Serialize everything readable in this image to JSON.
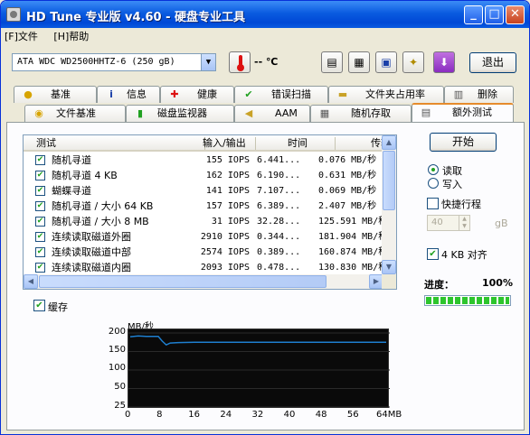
{
  "window": {
    "title": "HD Tune 专业版 v4.60 - 硬盘专业工具"
  },
  "menu": {
    "file": "[F]文件",
    "help": "[H]帮助"
  },
  "toolbar": {
    "disk": "ATA    WDC WD2500HHTZ-6 (250 gB)",
    "temperature": "-- ℃",
    "exit_label": "退出"
  },
  "tabs_top": [
    "基准",
    "信息",
    "健康",
    "错误扫描",
    "文件夹占用率",
    "删除"
  ],
  "tabs_bottom": [
    "文件基准",
    "磁盘监视器",
    "AAM",
    "随机存取",
    "额外测试"
  ],
  "table": {
    "headers": {
      "test": "测试",
      "io": "输入/输出",
      "time": "时间",
      "speed": "传输"
    },
    "rows": [
      {
        "name": "随机寻道",
        "io": "155 IOPS",
        "time": "6.441...",
        "speed": "0.076 MB/秒"
      },
      {
        "name": "随机寻道 4 KB",
        "io": "162 IOPS",
        "time": "6.190...",
        "speed": "0.631 MB/秒"
      },
      {
        "name": "蝴蝶寻道",
        "io": "141 IOPS",
        "time": "7.107...",
        "speed": "0.069 MB/秒"
      },
      {
        "name": "随机寻道 / 大小 64 KB",
        "io": "157 IOPS",
        "time": "6.389...",
        "speed": "2.407 MB/秒"
      },
      {
        "name": "随机寻道 / 大小 8 MB",
        "io": "31 IOPS",
        "time": "32.28...",
        "speed": "125.591 MB/秒"
      },
      {
        "name": "连续读取磁道外圈",
        "io": "2910 IOPS",
        "time": "0.344...",
        "speed": "181.904 MB/秒"
      },
      {
        "name": "连续读取磁道中部",
        "io": "2574 IOPS",
        "time": "0.389...",
        "speed": "160.874 MB/秒"
      },
      {
        "name": "连续读取磁道内圈",
        "io": "2093 IOPS",
        "time": "0.478...",
        "speed": "130.830 MB/秒"
      }
    ]
  },
  "side": {
    "start_label": "开始",
    "read_label": "读取",
    "write_label": "写入",
    "quick_label": "快捷行程",
    "quick_value": "40",
    "quick_unit": "gB",
    "align_label": "4 KB 对齐",
    "progress_label": "进度：",
    "progress_value": "100%"
  },
  "cache_label": "缓存",
  "chart_data": {
    "type": "line",
    "ylabel": "MB/秒",
    "yticks": [
      "200",
      "150",
      "100",
      "50",
      "25"
    ],
    "xticks": [
      "0",
      "8",
      "16",
      "24",
      "32",
      "40",
      "48",
      "56",
      "64MB"
    ],
    "ylim": [
      0,
      200
    ],
    "xlim": [
      0,
      64
    ],
    "x": [
      0,
      2,
      4,
      6,
      7,
      8,
      9,
      10,
      12,
      16,
      24,
      32,
      40,
      48,
      56,
      64
    ],
    "values": [
      190,
      192,
      191,
      191,
      191,
      178,
      168,
      173,
      174,
      175,
      175,
      175,
      175,
      175,
      175,
      175
    ],
    "color": "#1E7FD0"
  },
  "colors": {
    "title_bar": "#0A5BE0",
    "progress": "#2DC52D"
  }
}
